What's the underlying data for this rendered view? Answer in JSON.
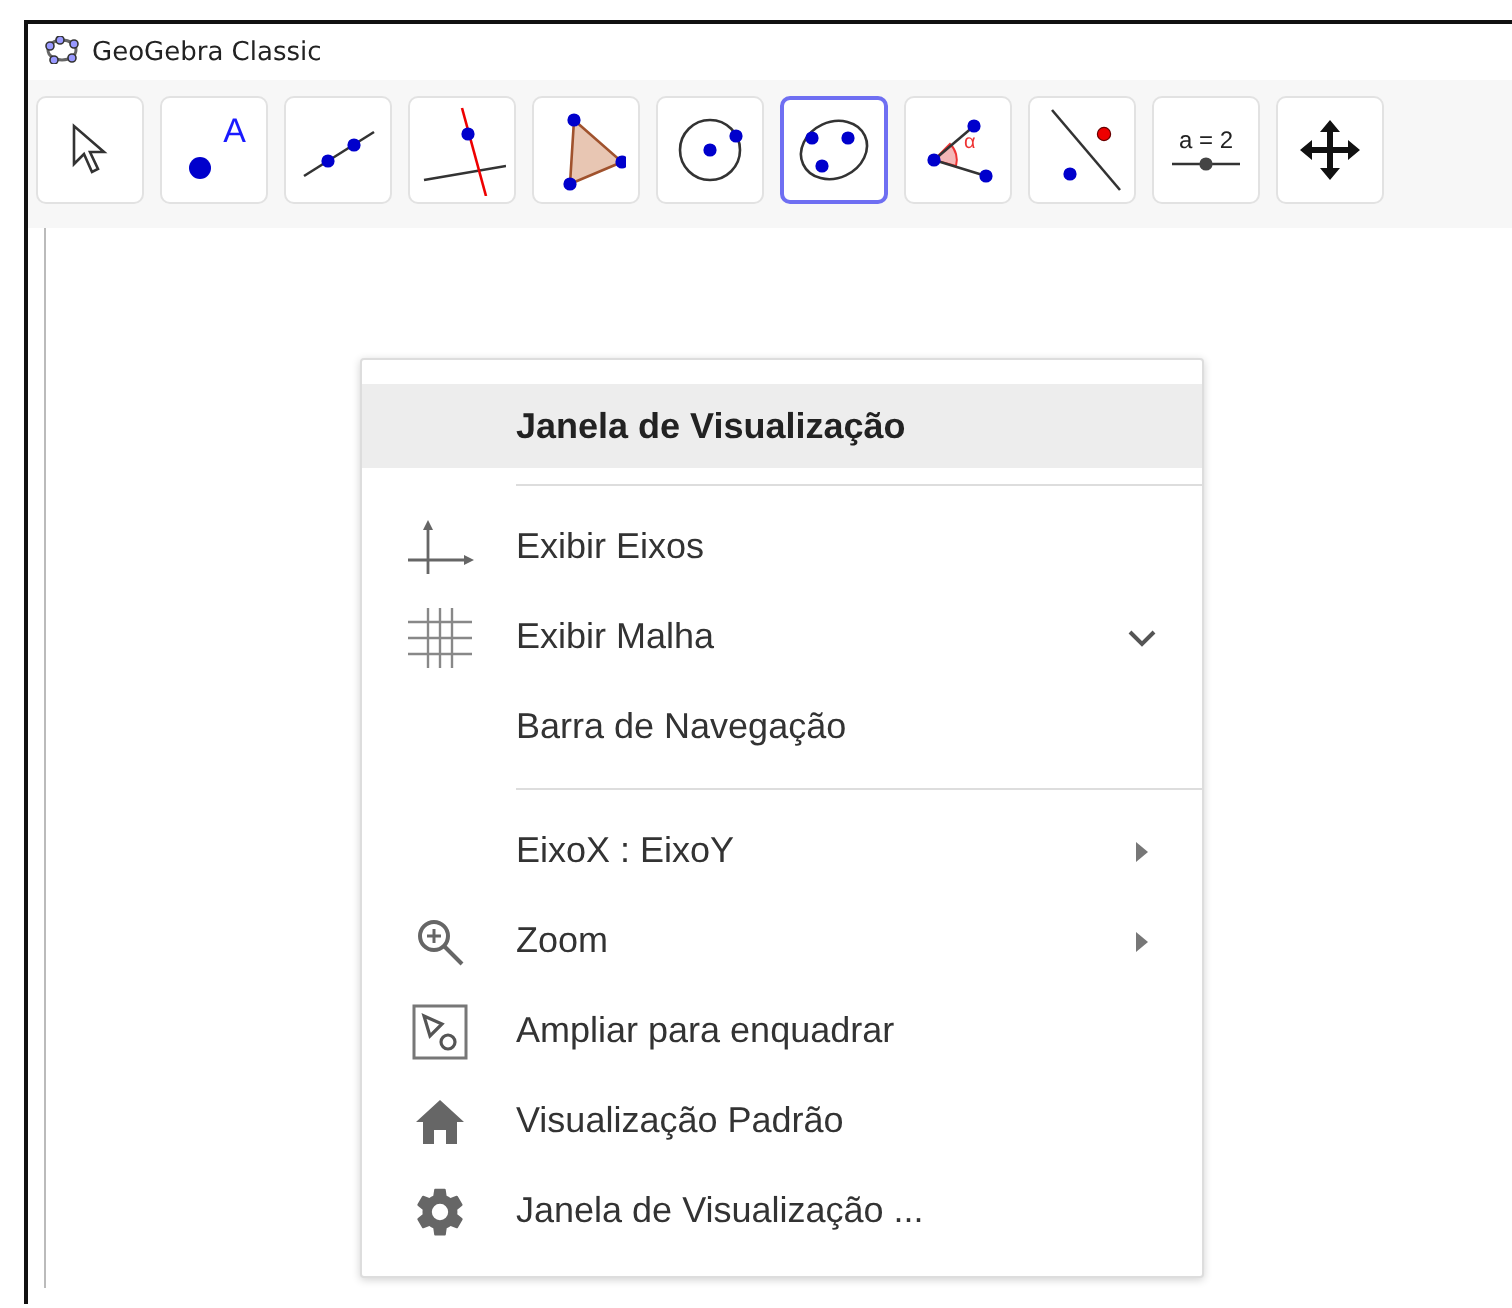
{
  "window": {
    "title": "GeoGebra Classic"
  },
  "toolbar": [
    {
      "kind": "move",
      "selected": false
    },
    {
      "kind": "point",
      "label": "A",
      "selected": false
    },
    {
      "kind": "line",
      "selected": false
    },
    {
      "kind": "perpendicular",
      "selected": false
    },
    {
      "kind": "polygon",
      "selected": false
    },
    {
      "kind": "circle",
      "selected": false
    },
    {
      "kind": "conic",
      "selected": true
    },
    {
      "kind": "angle",
      "label": "α",
      "selected": false
    },
    {
      "kind": "reflect",
      "selected": false
    },
    {
      "kind": "slider",
      "label": "a = 2",
      "selected": false
    },
    {
      "kind": "move-view",
      "selected": false
    }
  ],
  "context_menu": {
    "title": "Janela de Visualização",
    "groups": [
      [
        {
          "label": "Exibir Eixos",
          "kind": "axes"
        },
        {
          "label": "Exibir Malha",
          "kind": "grid",
          "expandable": true
        },
        {
          "label": "Barra de Navegação",
          "kind": "plain"
        }
      ],
      [
        {
          "label": "EixoX : EixoY",
          "kind": "plain",
          "submenu": true
        },
        {
          "label": "Zoom",
          "kind": "zoom",
          "submenu": true
        },
        {
          "label": "Ampliar para enquadrar",
          "kind": "fit"
        },
        {
          "label": "Visualização Padrão",
          "kind": "home"
        },
        {
          "label": "Janela de Visualização ...",
          "kind": "gear"
        }
      ]
    ]
  }
}
